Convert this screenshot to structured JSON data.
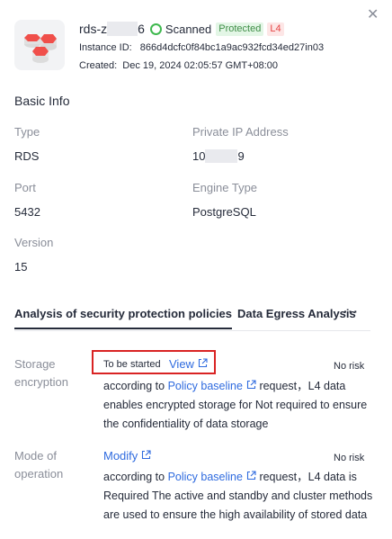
{
  "header": {
    "name_prefix": "rds-z",
    "name_suffix": "6",
    "scan_status": "Scanned",
    "protected_badge": "Protected",
    "level_badge": "L4",
    "instance_id_label": "Instance ID:",
    "instance_id": "866d4dcfc0f84bc1a9ac932fcd34ed27in03",
    "created_label": "Created:",
    "created_value": "Dec 19, 2024 02:05:57 GMT+08:00",
    "close_icon": "close-icon",
    "db_icon": "database-stack-icon"
  },
  "basic_info": {
    "title": "Basic Info",
    "type_label": "Type",
    "type_value": "RDS",
    "ip_label": "Private IP Address",
    "ip_prefix": "10",
    "ip_suffix": "9",
    "port_label": "Port",
    "port_value": "5432",
    "engine_label": "Engine Type",
    "engine_value": "PostgreSQL",
    "version_label": "Version",
    "version_value": "15"
  },
  "tabs": [
    {
      "label": "Analysis of security protection policies",
      "active": true
    },
    {
      "label": "Data Egress Analysis",
      "active": false
    }
  ],
  "more_label": "···",
  "policies": [
    {
      "label": "Storage encryption",
      "status": "To be started",
      "action": "View",
      "risk": "No risk",
      "desc_prefix": "according to ",
      "desc_link": "Policy baseline",
      "desc_rest": " request，L4 data enables encrypted storage for Not required to ensure the confidentiality of data storage"
    },
    {
      "label": "Mode of operation",
      "action": "Modify",
      "risk": "No risk",
      "desc_prefix": "according to ",
      "desc_link": "Policy baseline",
      "desc_rest": " request，L4 data is Required The active and standby and cluster methods are used to ensure the high availability of stored data"
    }
  ],
  "colors": {
    "link": "#2f6bdf",
    "scanned_green": "#3fb94f",
    "highlight_red": "#d92323",
    "icon_red": "#f04f4a"
  }
}
